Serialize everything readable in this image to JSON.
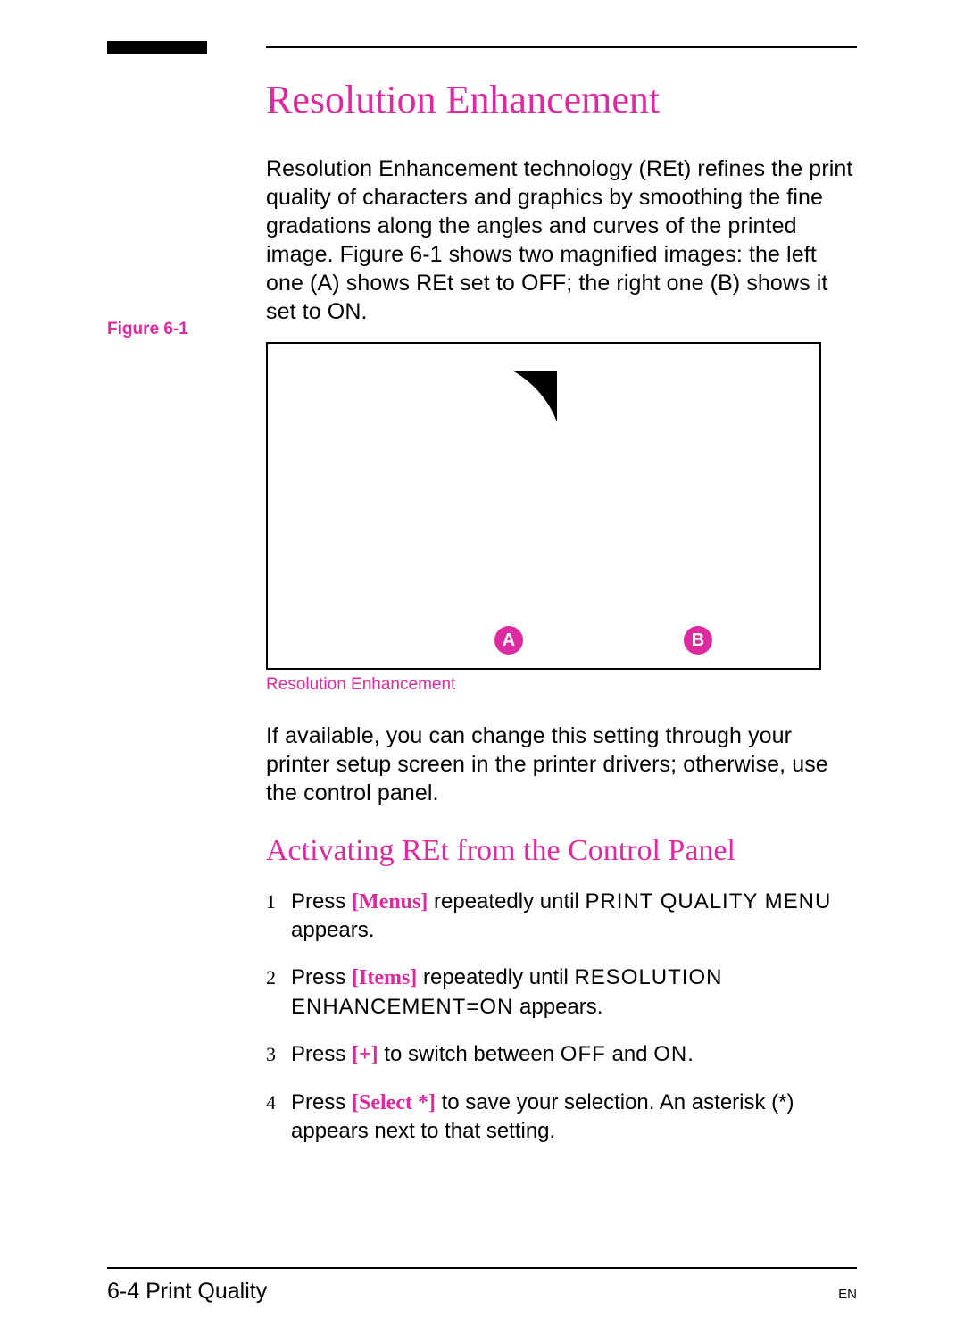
{
  "heading": "Resolution Enhancement",
  "intro": "Resolution Enhancement technology (REt) refines the print quality of characters and graphics by smoothing the fine gradations along the angles and curves of the printed image. Figure 6-1 shows two magnified images: the left one (A) shows REt set to OFF; the right one  (B) shows it set to ON.",
  "figure": {
    "label": "Figure 6-1",
    "badge_a": "A",
    "badge_b": "B",
    "caption": "Resolution Enhancement"
  },
  "post_figure": "If available, you can change this setting through your printer setup screen in the printer drivers; otherwise, use the control panel.",
  "subheading": "Activating REt from the Control Panel",
  "steps": [
    {
      "pre": "Press ",
      "key": "[Menus]",
      "mid": " repeatedly until ",
      "mono": "PRINT QUALITY MENU",
      "post": " appears."
    },
    {
      "pre": "Press ",
      "key": "[Items]",
      "mid": " repeatedly until ",
      "mono": "RESOLUTION ENHANCEMENT=ON",
      "post": " appears."
    },
    {
      "pre": "Press ",
      "key": "[+]",
      "mid": " to switch between ",
      "mono": "OFF",
      "mid2": " and ",
      "mono2": "ON",
      "post": "."
    },
    {
      "pre": "Press ",
      "key": "[Select *]",
      "mid": " to save your selection. An asterisk (*) appears next to that setting.",
      "mono": "",
      "post": ""
    }
  ],
  "footer": {
    "page": "6-4   Print Quality",
    "lang": "EN"
  }
}
